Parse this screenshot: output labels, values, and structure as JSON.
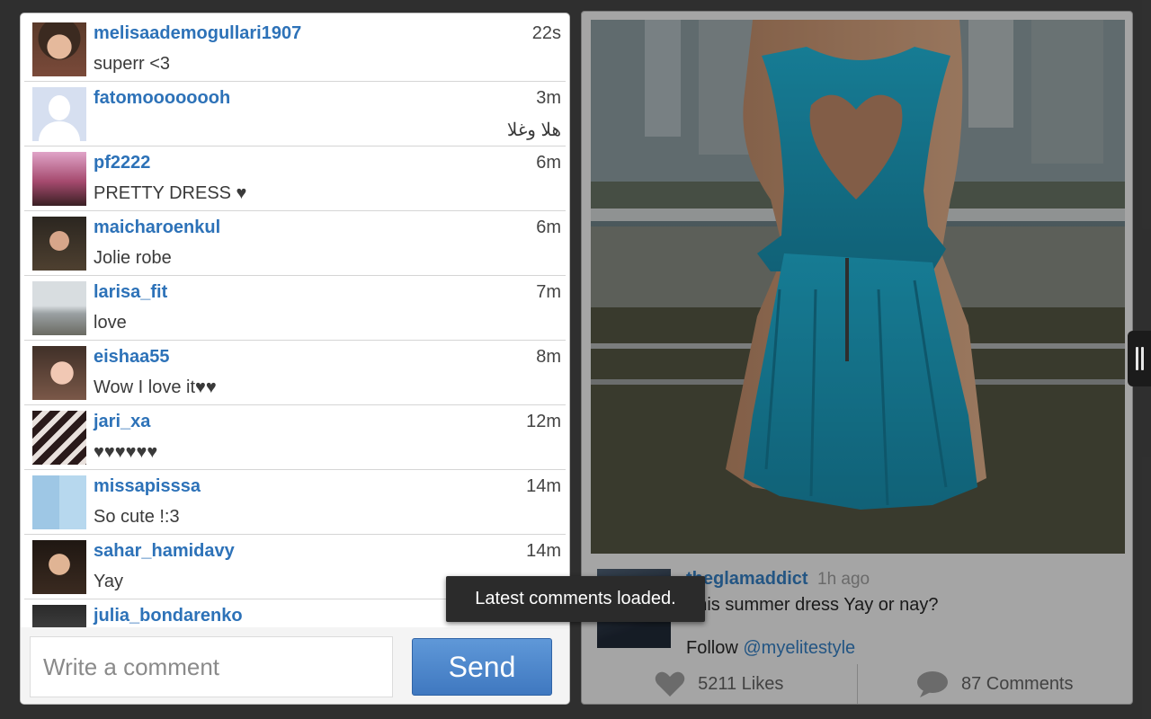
{
  "comments": [
    {
      "user": "melisaademogullari1907",
      "time": "22s",
      "text": "superr <3",
      "avatar": "face"
    },
    {
      "user": "fatomoooooooh",
      "time": "3m",
      "text": "هلا وغلا",
      "avatar": "default"
    },
    {
      "user": "pf2222",
      "time": "6m",
      "text": "PRETTY DRESS ♥",
      "avatar": "sunset"
    },
    {
      "user": "maicharoenkul",
      "time": "6m",
      "text": "Jolie robe",
      "avatar": "dark"
    },
    {
      "user": "larisa_fit",
      "time": "7m",
      "text": "love",
      "avatar": "beach"
    },
    {
      "user": "eishaa55",
      "time": "8m",
      "text": "Wow I love it♥♥",
      "avatar": "girl2"
    },
    {
      "user": "jari_xa",
      "time": "12m",
      "text": "♥♥♥♥♥♥",
      "avatar": "stripes"
    },
    {
      "user": "missapisssa",
      "time": "14m",
      "text": "So cute !:3",
      "avatar": "collage"
    },
    {
      "user": "sahar_hamidavy",
      "time": "14m",
      "text": "Yay",
      "avatar": "sahar"
    },
    {
      "user": "julia_bondarenko",
      "time": "",
      "text": "",
      "avatar": "julia"
    }
  ],
  "composer": {
    "placeholder": "Write a comment",
    "send_label": "Send"
  },
  "toast": "Latest comments loaded.",
  "post": {
    "author": "theglamaddict",
    "time": "1h ago",
    "caption": "This summer dress Yay or nay?",
    "follow_prefix": "Follow ",
    "follow_handle": "@myelitestyle",
    "likes": "5211 Likes",
    "comments": "87 Comments"
  },
  "colors": {
    "link": "#2d72b8",
    "send_button": "#4a86cc",
    "toast_bg": "#2b2b2b"
  }
}
